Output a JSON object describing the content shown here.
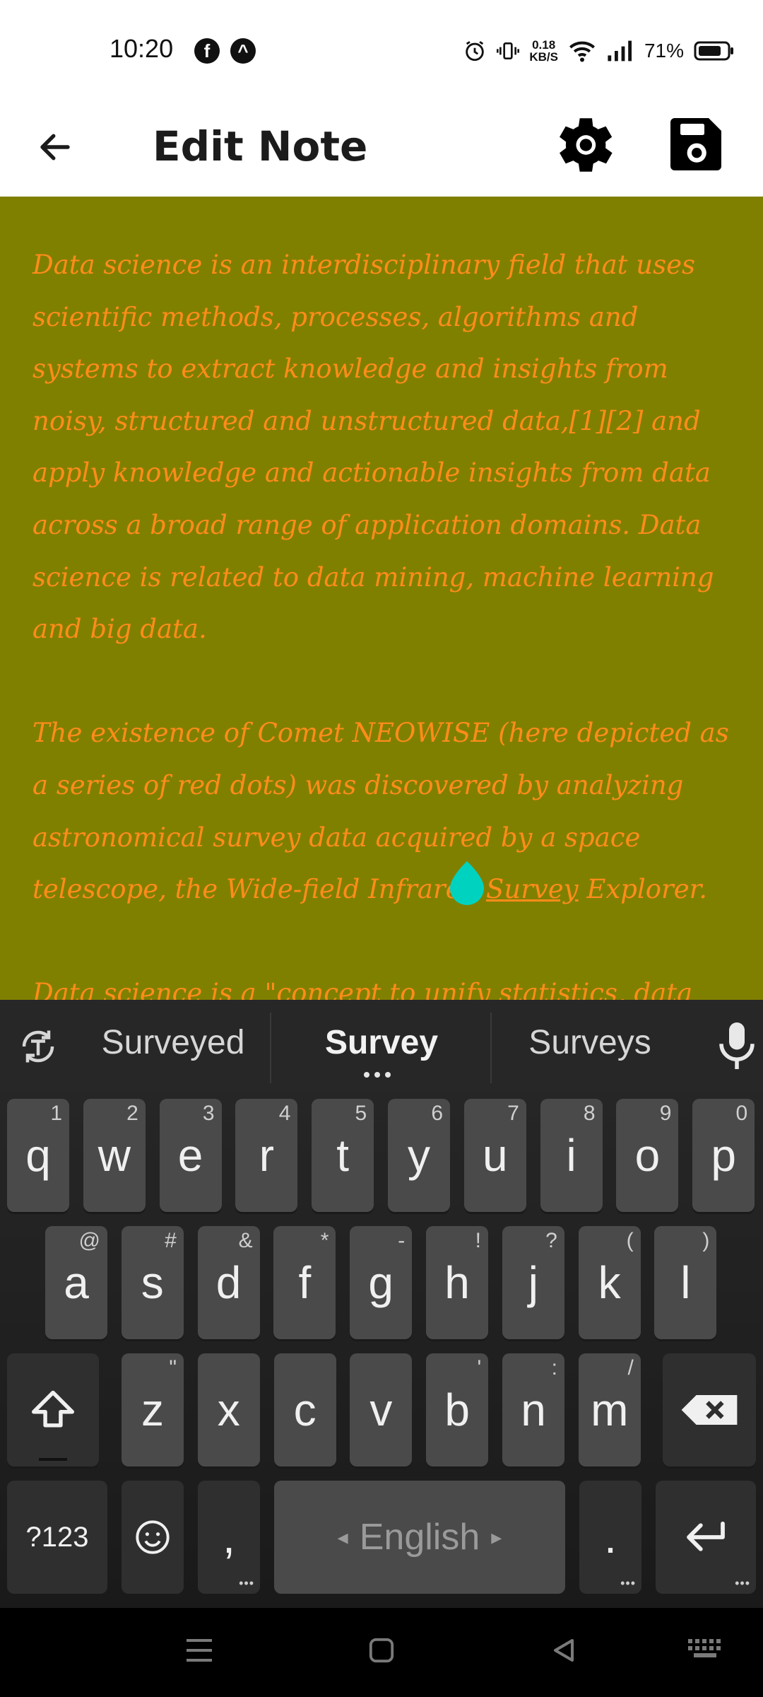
{
  "status_bar": {
    "time": "10:20",
    "app_icons": [
      "facebook-icon",
      "app-icon"
    ],
    "app_icon_glyphs": [
      "f",
      "^"
    ],
    "speed_value": "0.18",
    "speed_unit": "KB/S",
    "battery": "71%"
  },
  "app_bar": {
    "title": "Edit Note",
    "back_icon": "arrow-left-icon",
    "settings_icon": "gear-icon",
    "save_icon": "floppy-disk-icon"
  },
  "editor": {
    "background": "#808000",
    "text_color": "#ff8c1a",
    "paragraph1": "Data science is an interdisciplinary field that uses scientific methods, processes, algorithms and systems to extract knowledge and insights from noisy, structured and unstructured data,[1][2] and apply knowledge and actionable insights from data across a broad range of application domains. Data science is related to data mining, machine learning and big data.",
    "paragraph2_before": "The existence of Comet NEOWISE (here depicted as a series of red dots) was discovered by analyzing astronomical survey data acquired by a space telescope, the Wide-field Infrared ",
    "paragraph2_selected": "Survey",
    "paragraph2_after": " Explorer.",
    "paragraph3": "Data science is a \"concept to unify statistics, data",
    "cursor_color": "#00d2c0"
  },
  "suggestions": {
    "left": "Surveyed",
    "center": "Survey",
    "right": "Surveys"
  },
  "keyboard": {
    "row1": [
      {
        "k": "q",
        "h": "1"
      },
      {
        "k": "w",
        "h": "2"
      },
      {
        "k": "e",
        "h": "3"
      },
      {
        "k": "r",
        "h": "4"
      },
      {
        "k": "t",
        "h": "5"
      },
      {
        "k": "y",
        "h": "6"
      },
      {
        "k": "u",
        "h": "7"
      },
      {
        "k": "i",
        "h": "8"
      },
      {
        "k": "o",
        "h": "9"
      },
      {
        "k": "p",
        "h": "0"
      }
    ],
    "row2": [
      {
        "k": "a",
        "h": "@"
      },
      {
        "k": "s",
        "h": "#"
      },
      {
        "k": "d",
        "h": "&"
      },
      {
        "k": "f",
        "h": "*"
      },
      {
        "k": "g",
        "h": "-"
      },
      {
        "k": "h",
        "h": "!"
      },
      {
        "k": "j",
        "h": "?"
      },
      {
        "k": "k",
        "h": "("
      },
      {
        "k": "l",
        "h": ")"
      }
    ],
    "row3": [
      {
        "k": "z",
        "h": "\""
      },
      {
        "k": "x",
        "h": ""
      },
      {
        "k": "c",
        "h": ""
      },
      {
        "k": "v",
        "h": ""
      },
      {
        "k": "b",
        "h": "'"
      },
      {
        "k": "n",
        "h": ":"
      },
      {
        "k": "m",
        "h": "/"
      }
    ],
    "symbols_key": "?123",
    "comma_key": ",",
    "space_label": "English",
    "period_key": ".",
    "space_left_arrow": "◂",
    "space_right_arrow": "▸"
  }
}
